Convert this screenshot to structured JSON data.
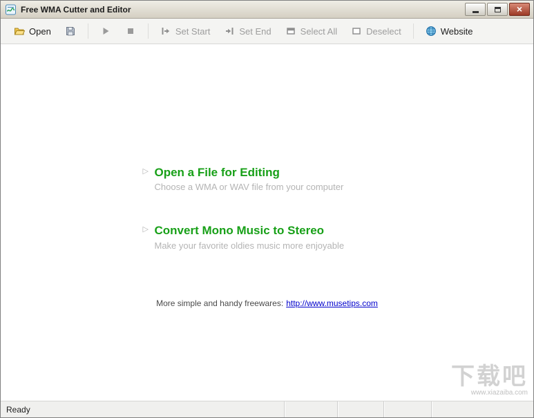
{
  "window": {
    "title": "Free WMA Cutter and Editor"
  },
  "toolbar": {
    "open_label": "Open",
    "set_start_label": "Set Start",
    "set_end_label": "Set End",
    "select_all_label": "Select All",
    "deselect_label": "Deselect",
    "website_label": "Website",
    "icons": {
      "open": "open-folder-icon",
      "save": "save-floppy-icon",
      "play": "play-icon",
      "stop": "stop-icon",
      "set_start": "set-start-icon",
      "set_end": "set-end-icon",
      "select_all": "select-all-icon",
      "deselect": "deselect-icon",
      "website": "globe-icon"
    },
    "disabled_items": [
      "save",
      "play",
      "stop",
      "set_start",
      "set_end",
      "select_all",
      "deselect"
    ]
  },
  "main": {
    "actions": [
      {
        "title": "Open a File for Editing",
        "subtitle": "Choose a WMA or WAV file from your computer"
      },
      {
        "title": "Convert Mono Music to Stereo",
        "subtitle": "Make your favorite oldies music more enjoyable"
      }
    ],
    "footer": {
      "text": "More simple and handy freewares:",
      "link": "http://www.musetips.com"
    }
  },
  "statusbar": {
    "text": "Ready"
  },
  "watermark": {
    "title": "下载吧",
    "url": "www.xiazaiba.com"
  },
  "colors": {
    "heading_green": "#18a018",
    "subtitle_gray": "#b4b4b4",
    "link_blue": "#0000cc",
    "close_button_red": "#9c3a26"
  }
}
